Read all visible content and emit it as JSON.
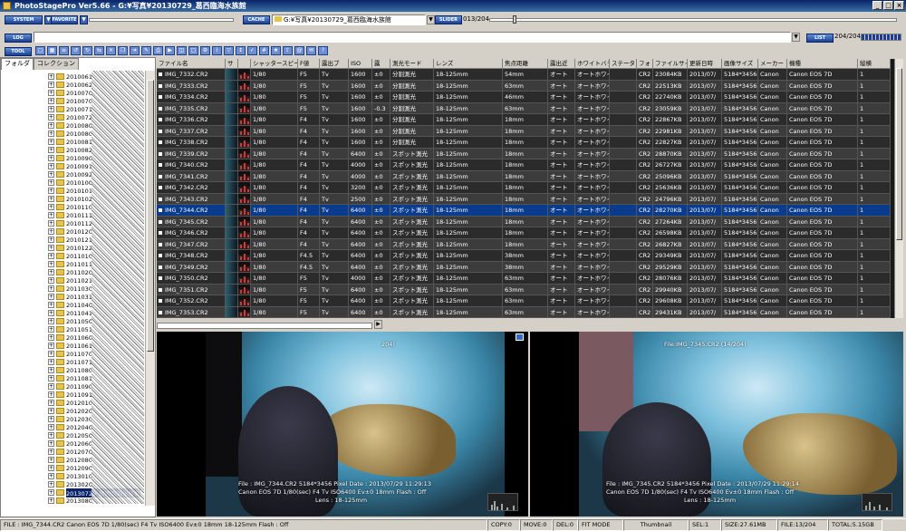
{
  "window": {
    "title": "PhotoStagePro Ver5.66 - G:¥写真¥20130729_葛西臨海水族館",
    "controls": [
      "_",
      "□",
      "×"
    ]
  },
  "toolbar1": {
    "system_label": "SYSTEM",
    "favorite_label": "FAVORITE",
    "cache_label": "CACHE",
    "path_value": "G:¥写真¥20130729_葛西臨海水族館",
    "slider_label": "SLIDER",
    "slider_value": "013/204"
  },
  "toolbar2": {
    "log_label": "LOG",
    "list_label": "LIST",
    "list_count": "204/204"
  },
  "toolbar3": {
    "tool_label": "TOOL",
    "icons": [
      "select-icon",
      "grid-icon",
      "list-icon",
      "rotate-left-icon",
      "rotate-right-icon",
      "flip-icon",
      "delete-icon",
      "copy-icon",
      "move-icon",
      "rename-icon",
      "print-icon",
      "slideshow-icon",
      "compare-icon",
      "fullscreen-icon",
      "settings-icon",
      "info-icon",
      "filter-icon",
      "sort-icon",
      "mark-icon",
      "tag-icon",
      "star-icon",
      "export-icon",
      "web-icon",
      "mail-icon",
      "help-icon"
    ]
  },
  "folder_panel": {
    "tabs": [
      "フォルダ",
      "コレクション"
    ],
    "items": [
      {
        "label": "2010061",
        "sel": false
      },
      {
        "label": "2010062",
        "sel": false
      },
      {
        "label": "2010070",
        "sel": false
      },
      {
        "label": "2010070",
        "sel": false
      },
      {
        "label": "2010071",
        "sel": false
      },
      {
        "label": "2010072",
        "sel": false
      },
      {
        "label": "2010080",
        "sel": false
      },
      {
        "label": "2010080",
        "sel": false
      },
      {
        "label": "2010081",
        "sel": false
      },
      {
        "label": "2010082",
        "sel": false
      },
      {
        "label": "2010090",
        "sel": false
      },
      {
        "label": "2010091",
        "sel": false
      },
      {
        "label": "2010092",
        "sel": false
      },
      {
        "label": "2010100",
        "sel": false
      },
      {
        "label": "2010101",
        "sel": false
      },
      {
        "label": "2010102",
        "sel": false
      },
      {
        "label": "2010110",
        "sel": false
      },
      {
        "label": "2010111",
        "sel": false
      },
      {
        "label": "2010112",
        "sel": false
      },
      {
        "label": "2010120",
        "sel": false
      },
      {
        "label": "2010121",
        "sel": false
      },
      {
        "label": "2010122",
        "sel": false
      },
      {
        "label": "2011010",
        "sel": false
      },
      {
        "label": "2011011",
        "sel": false
      },
      {
        "label": "2011020",
        "sel": false
      },
      {
        "label": "2011021",
        "sel": false
      },
      {
        "label": "2011030",
        "sel": false
      },
      {
        "label": "2011031",
        "sel": false
      },
      {
        "label": "2011040",
        "sel": false
      },
      {
        "label": "2011041",
        "sel": false
      },
      {
        "label": "2011050",
        "sel": false
      },
      {
        "label": "2011051",
        "sel": false
      },
      {
        "label": "2011060",
        "sel": false
      },
      {
        "label": "2011061",
        "sel": false
      },
      {
        "label": "2011070",
        "sel": false
      },
      {
        "label": "2011071",
        "sel": false
      },
      {
        "label": "2011080",
        "sel": false
      },
      {
        "label": "2011081",
        "sel": false
      },
      {
        "label": "2011090",
        "sel": false
      },
      {
        "label": "2011091",
        "sel": false
      },
      {
        "label": "2012010",
        "sel": false
      },
      {
        "label": "2012020",
        "sel": false
      },
      {
        "label": "2012030",
        "sel": false
      },
      {
        "label": "2012040",
        "sel": false
      },
      {
        "label": "2012050",
        "sel": false
      },
      {
        "label": "2012060",
        "sel": false
      },
      {
        "label": "2012070",
        "sel": false
      },
      {
        "label": "2012080",
        "sel": false
      },
      {
        "label": "2012090",
        "sel": false
      },
      {
        "label": "2013010",
        "sel": false
      },
      {
        "label": "2013020",
        "sel": false
      },
      {
        "label": "20130729_葛西臨海水族館",
        "sel": true
      },
      {
        "label": "2013080",
        "sel": false
      },
      {
        "label": "2013081",
        "sel": false
      }
    ]
  },
  "table": {
    "columns": [
      {
        "label": "ファイル名",
        "w": 76
      },
      {
        "label": "サ",
        "w": 14
      },
      {
        "label": "",
        "w": 14
      },
      {
        "label": "シャッタースピード",
        "w": 52
      },
      {
        "label": "F値",
        "w": 24
      },
      {
        "label": "露出ブ",
        "w": 32
      },
      {
        "label": "ISO",
        "w": 26
      },
      {
        "label": "露",
        "w": 20
      },
      {
        "label": "測光モード",
        "w": 48
      },
      {
        "label": "レンズ",
        "w": 76
      },
      {
        "label": "焦点距離",
        "w": 50
      },
      {
        "label": "露出近",
        "w": 30
      },
      {
        "label": "ホワイトバランス",
        "w": 38
      },
      {
        "label": "ステータス",
        "w": 30
      },
      {
        "label": "フォ",
        "w": 18
      },
      {
        "label": "ファイルサイズ",
        "w": 38
      },
      {
        "label": "更新日時",
        "w": 38
      },
      {
        "label": "画像サイズ",
        "w": 40
      },
      {
        "label": "メーカー",
        "w": 32
      },
      {
        "label": "機種",
        "w": 78
      },
      {
        "label": "縦横",
        "w": 36
      }
    ],
    "rows": [
      [
        "IMG_7332.CR2",
        "1/80",
        "F5",
        "Tv",
        "1600",
        "±0",
        "分割測光",
        "18-125mm",
        "54mm",
        "オート",
        "オートホワイト",
        "",
        "CR2",
        "23084KB",
        "2013/07/",
        "5184*3456",
        "Canon",
        "Canon EOS 7D",
        "1"
      ],
      [
        "IMG_7333.CR2",
        "1/80",
        "F5",
        "Tv",
        "1600",
        "±0",
        "分割測光",
        "18-125mm",
        "63mm",
        "オート",
        "オートホワイト",
        "",
        "CR2",
        "22513KB",
        "2013/07/",
        "5184*3456",
        "Canon",
        "Canon EOS 7D",
        "1"
      ],
      [
        "IMG_7334.CR2",
        "1/80",
        "F5",
        "Tv",
        "1600",
        "±0",
        "分割測光",
        "18-125mm",
        "46mm",
        "オート",
        "オートホワイト",
        "",
        "CR2",
        "22740KB",
        "2013/07/",
        "5184*3456",
        "Canon",
        "Canon EOS 7D",
        "1"
      ],
      [
        "IMG_7335.CR2",
        "1/80",
        "F5",
        "Tv",
        "1600",
        "-0.3",
        "分割測光",
        "18-125mm",
        "63mm",
        "オート",
        "オートホワイト",
        "",
        "CR2",
        "23059KB",
        "2013/07/",
        "5184*3456",
        "Canon",
        "Canon EOS 7D",
        "1"
      ],
      [
        "IMG_7336.CR2",
        "1/80",
        "F4",
        "Tv",
        "1600",
        "±0",
        "分割測光",
        "18-125mm",
        "18mm",
        "オート",
        "オートホワイト",
        "",
        "CR2",
        "22867KB",
        "2013/07/",
        "5184*3456",
        "Canon",
        "Canon EOS 7D",
        "1"
      ],
      [
        "IMG_7337.CR2",
        "1/80",
        "F4",
        "Tv",
        "1600",
        "±0",
        "分割測光",
        "18-125mm",
        "18mm",
        "オート",
        "オートホワイト",
        "",
        "CR2",
        "22981KB",
        "2013/07/",
        "5184*3456",
        "Canon",
        "Canon EOS 7D",
        "1"
      ],
      [
        "IMG_7338.CR2",
        "1/80",
        "F4",
        "Tv",
        "1600",
        "±0",
        "分割測光",
        "18-125mm",
        "18mm",
        "オート",
        "オートホワイト",
        "",
        "CR2",
        "22827KB",
        "2013/07/",
        "5184*3456",
        "Canon",
        "Canon EOS 7D",
        "1"
      ],
      [
        "IMG_7339.CR2",
        "1/80",
        "F4",
        "Tv",
        "6400",
        "±0",
        "スポット測光",
        "18-125mm",
        "18mm",
        "オート",
        "オートホワイト",
        "",
        "CR2",
        "28870KB",
        "2013/07/",
        "5184*3456",
        "Canon",
        "Canon EOS 7D",
        "1"
      ],
      [
        "IMG_7340.CR2",
        "1/80",
        "F4",
        "Tv",
        "4000",
        "±0",
        "スポット測光",
        "18-125mm",
        "18mm",
        "オート",
        "オートホワイト",
        "",
        "CR2",
        "26727KB",
        "2013/07/",
        "5184*3456",
        "Canon",
        "Canon EOS 7D",
        "1"
      ],
      [
        "IMG_7341.CR2",
        "1/80",
        "F4",
        "Tv",
        "4000",
        "±0",
        "スポット測光",
        "18-125mm",
        "18mm",
        "オート",
        "オートホワイト",
        "",
        "CR2",
        "25096KB",
        "2013/07/",
        "5184*3456",
        "Canon",
        "Canon EOS 7D",
        "1"
      ],
      [
        "IMG_7342.CR2",
        "1/80",
        "F4",
        "Tv",
        "3200",
        "±0",
        "スポット測光",
        "18-125mm",
        "18mm",
        "オート",
        "オートホワイト",
        "",
        "CR2",
        "25636KB",
        "2013/07/",
        "5184*3456",
        "Canon",
        "Canon EOS 7D",
        "1"
      ],
      [
        "IMG_7343.CR2",
        "1/80",
        "F4",
        "Tv",
        "2500",
        "±0",
        "スポット測光",
        "18-125mm",
        "18mm",
        "オート",
        "オートホワイト",
        "",
        "CR2",
        "24796KB",
        "2013/07/",
        "5184*3456",
        "Canon",
        "Canon EOS 7D",
        "1"
      ],
      [
        "IMG_7344.CR2",
        "1/80",
        "F4",
        "Tv",
        "6400",
        "±0",
        "スポット測光",
        "18-125mm",
        "18mm",
        "オート",
        "オートホワイト",
        "",
        "CR2",
        "28270KB",
        "2013/07/",
        "5184*3456",
        "Canon",
        "Canon EOS 7D",
        "1"
      ],
      [
        "IMG_7345.CR2",
        "1/80",
        "F4",
        "Tv",
        "6400",
        "±0",
        "スポット測光",
        "18-125mm",
        "18mm",
        "オート",
        "オートホワイト",
        "",
        "CR2",
        "27264KB",
        "2013/07/",
        "5184*3456",
        "Canon",
        "Canon EOS 7D",
        "1"
      ],
      [
        "IMG_7346.CR2",
        "1/80",
        "F4",
        "Tv",
        "6400",
        "±0",
        "スポット測光",
        "18-125mm",
        "18mm",
        "オート",
        "オートホワイト",
        "",
        "CR2",
        "26598KB",
        "2013/07/",
        "5184*3456",
        "Canon",
        "Canon EOS 7D",
        "1"
      ],
      [
        "IMG_7347.CR2",
        "1/80",
        "F4",
        "Tv",
        "6400",
        "±0",
        "スポット測光",
        "18-125mm",
        "18mm",
        "オート",
        "オートホワイト",
        "",
        "CR2",
        "26827KB",
        "2013/07/",
        "5184*3456",
        "Canon",
        "Canon EOS 7D",
        "1"
      ],
      [
        "IMG_7348.CR2",
        "1/80",
        "F4.5",
        "Tv",
        "6400",
        "±0",
        "スポット測光",
        "18-125mm",
        "38mm",
        "オート",
        "オートホワイト",
        "",
        "CR2",
        "29349KB",
        "2013/07/",
        "5184*3456",
        "Canon",
        "Canon EOS 7D",
        "1"
      ],
      [
        "IMG_7349.CR2",
        "1/80",
        "F4.5",
        "Tv",
        "6400",
        "±0",
        "スポット測光",
        "18-125mm",
        "38mm",
        "オート",
        "オートホワイト",
        "",
        "CR2",
        "29529KB",
        "2013/07/",
        "5184*3456",
        "Canon",
        "Canon EOS 7D",
        "1"
      ],
      [
        "IMG_7350.CR2",
        "1/80",
        "F5",
        "Tv",
        "4000",
        "±0",
        "スポット測光",
        "18-125mm",
        "63mm",
        "オート",
        "オートホワイト",
        "",
        "CR2",
        "28076KB",
        "2013/07/",
        "5184*3456",
        "Canon",
        "Canon EOS 7D",
        "1"
      ],
      [
        "IMG_7351.CR2",
        "1/80",
        "F5",
        "Tv",
        "6400",
        "±0",
        "スポット測光",
        "18-125mm",
        "63mm",
        "オート",
        "オートホワイト",
        "",
        "CR2",
        "29940KB",
        "2013/07/",
        "5184*3456",
        "Canon",
        "Canon EOS 7D",
        "1"
      ],
      [
        "IMG_7352.CR2",
        "1/80",
        "F5",
        "Tv",
        "6400",
        "±0",
        "スポット測光",
        "18-125mm",
        "63mm",
        "オート",
        "オートホワイト",
        "",
        "CR2",
        "29608KB",
        "2013/07/",
        "5184*3456",
        "Canon",
        "Canon EOS 7D",
        "1"
      ],
      [
        "IMG_7353.CR2",
        "1/80",
        "F5",
        "Tv",
        "6400",
        "±0",
        "スポット測光",
        "18-125mm",
        "63mm",
        "オート",
        "オートホワイト",
        "",
        "CR2",
        "29431KB",
        "2013/07/",
        "5184*3456",
        "Canon",
        "Canon EOS 7D",
        "1"
      ]
    ],
    "selected_row": 12
  },
  "viewer_left": {
    "header": "204)",
    "line1": "File : IMG_7344.CR2  5184*3456 Pixel  Date : 2013/07/29 11:29:13",
    "line2": "Canon EOS 7D  1/80(sec)  F4  Tv  ISO6400  Ev±0  18mm  Flash : Off",
    "line3": "Lens : 18-125mm"
  },
  "viewer_right": {
    "header": "File:IMG_7345.CR2   (14/204)",
    "line1": "File : IMG_7345.CR2  5184*3456 Pixel  Date : 2013/07/29 11:29:14",
    "line2": "Canon EOS 7D  1/80(sec)  F4  Tv  ISO6400  Ev±0  18mm  Flash : Off",
    "line3": "Lens : 18-125mm"
  },
  "status": {
    "file": "FILE : IMG_7344.CR2  Canon EOS 7D  1/80(sec)  F4  Tv  ISO6400  Ev±0  18mm  18-125mm  Flash : Off",
    "copy": "COPY:0",
    "move": "MOVE:0",
    "del": "DEL:0",
    "fit": "FIT MODE",
    "thumb": "Thumbnail",
    "sel": "SEL:1",
    "size": "SIZE:27.61MB",
    "filecount": "FILE:13/204",
    "total": "TOTAL:5.15GB"
  }
}
